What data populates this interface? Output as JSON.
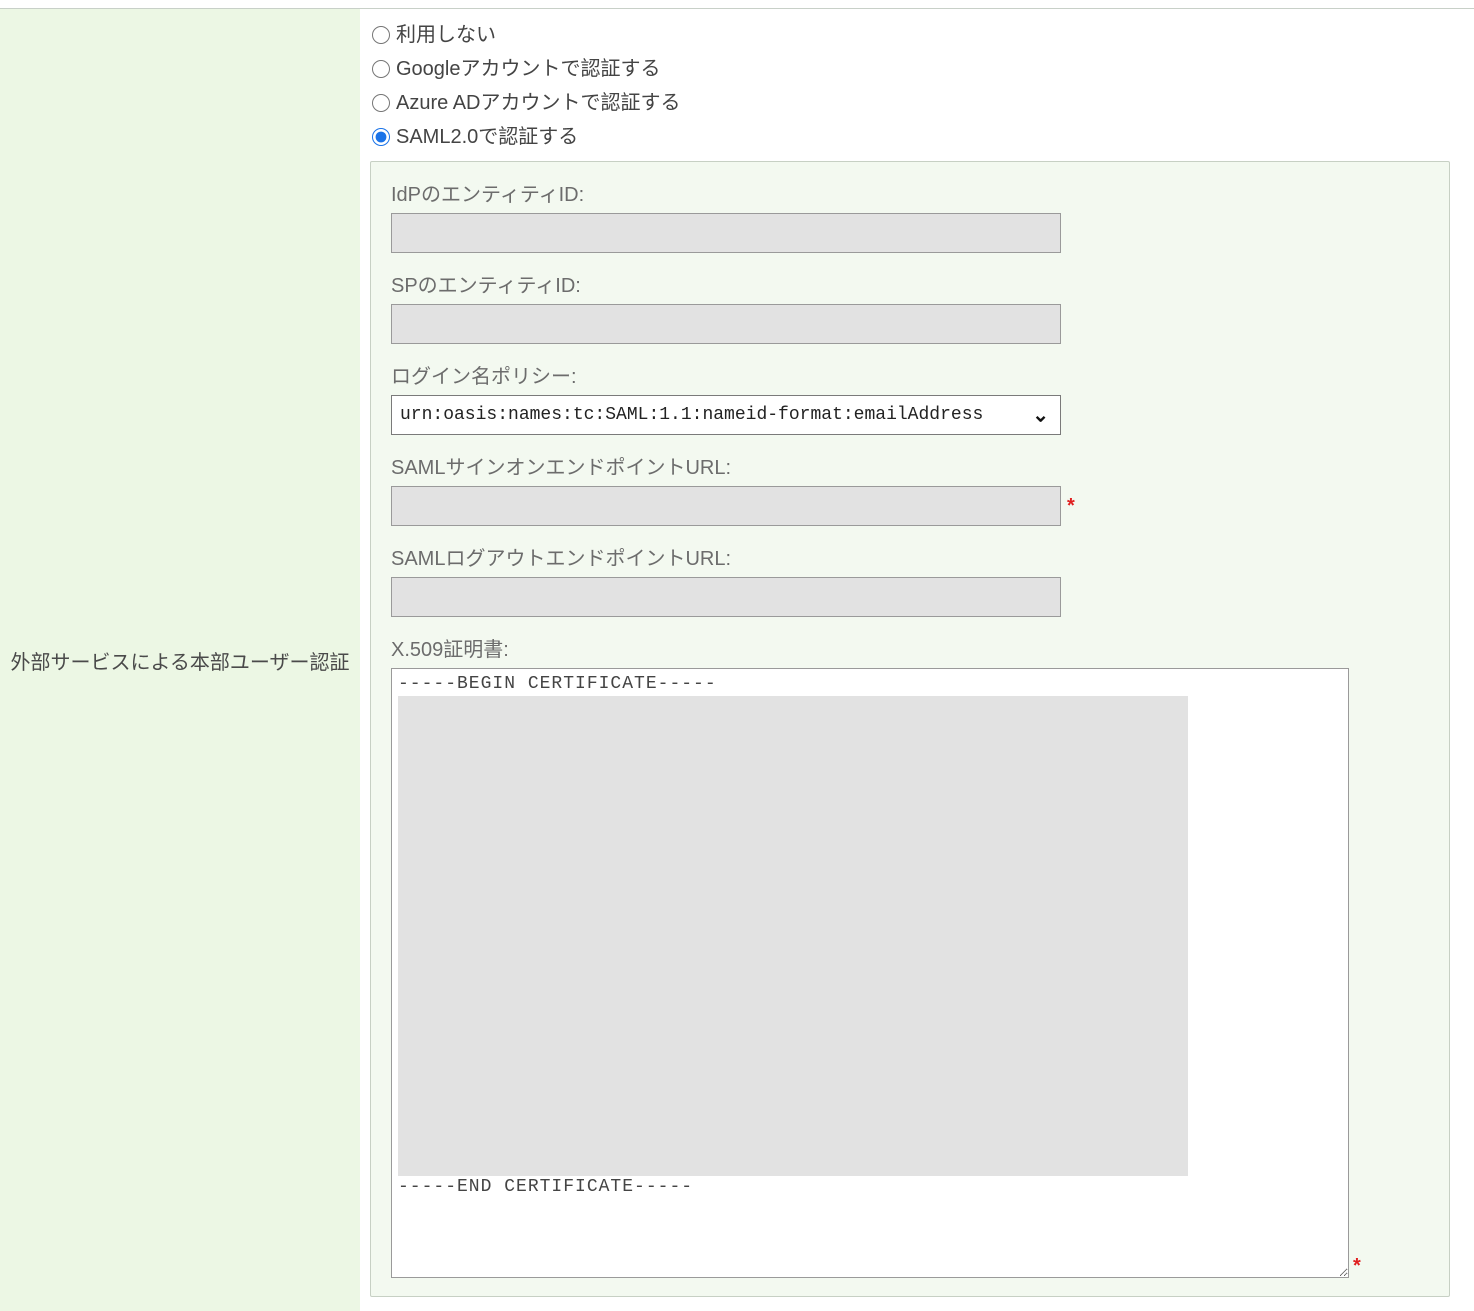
{
  "section": {
    "label": "外部サービスによる本部ユーザー認証"
  },
  "auth_options": {
    "none": {
      "label": "利用しない",
      "selected": false
    },
    "google": {
      "label": "Googleアカウントで認証する",
      "selected": false
    },
    "azure": {
      "label": "Azure ADアカウントで認証する",
      "selected": false
    },
    "saml": {
      "label": "SAML2.0で認証する",
      "selected": true
    }
  },
  "saml": {
    "idp_entity_id": {
      "label": "IdPのエンティティID:",
      "value": ""
    },
    "sp_entity_id": {
      "label": "SPのエンティティID:",
      "value": ""
    },
    "login_name_policy": {
      "label": "ログイン名ポリシー:",
      "value": "urn:oasis:names:tc:SAML:1.1:nameid-format:emailAddress"
    },
    "signon_endpoint": {
      "label": "SAMLサインオンエンドポイントURL:",
      "value": "",
      "required_mark": "*"
    },
    "logout_endpoint": {
      "label": "SAMLログアウトエンドポイントURL:",
      "value": ""
    },
    "certificate": {
      "label": "X.509証明書:",
      "begin": "-----BEGIN CERTIFICATE-----",
      "end": "-----END CERTIFICATE-----",
      "required_mark": "*"
    }
  }
}
